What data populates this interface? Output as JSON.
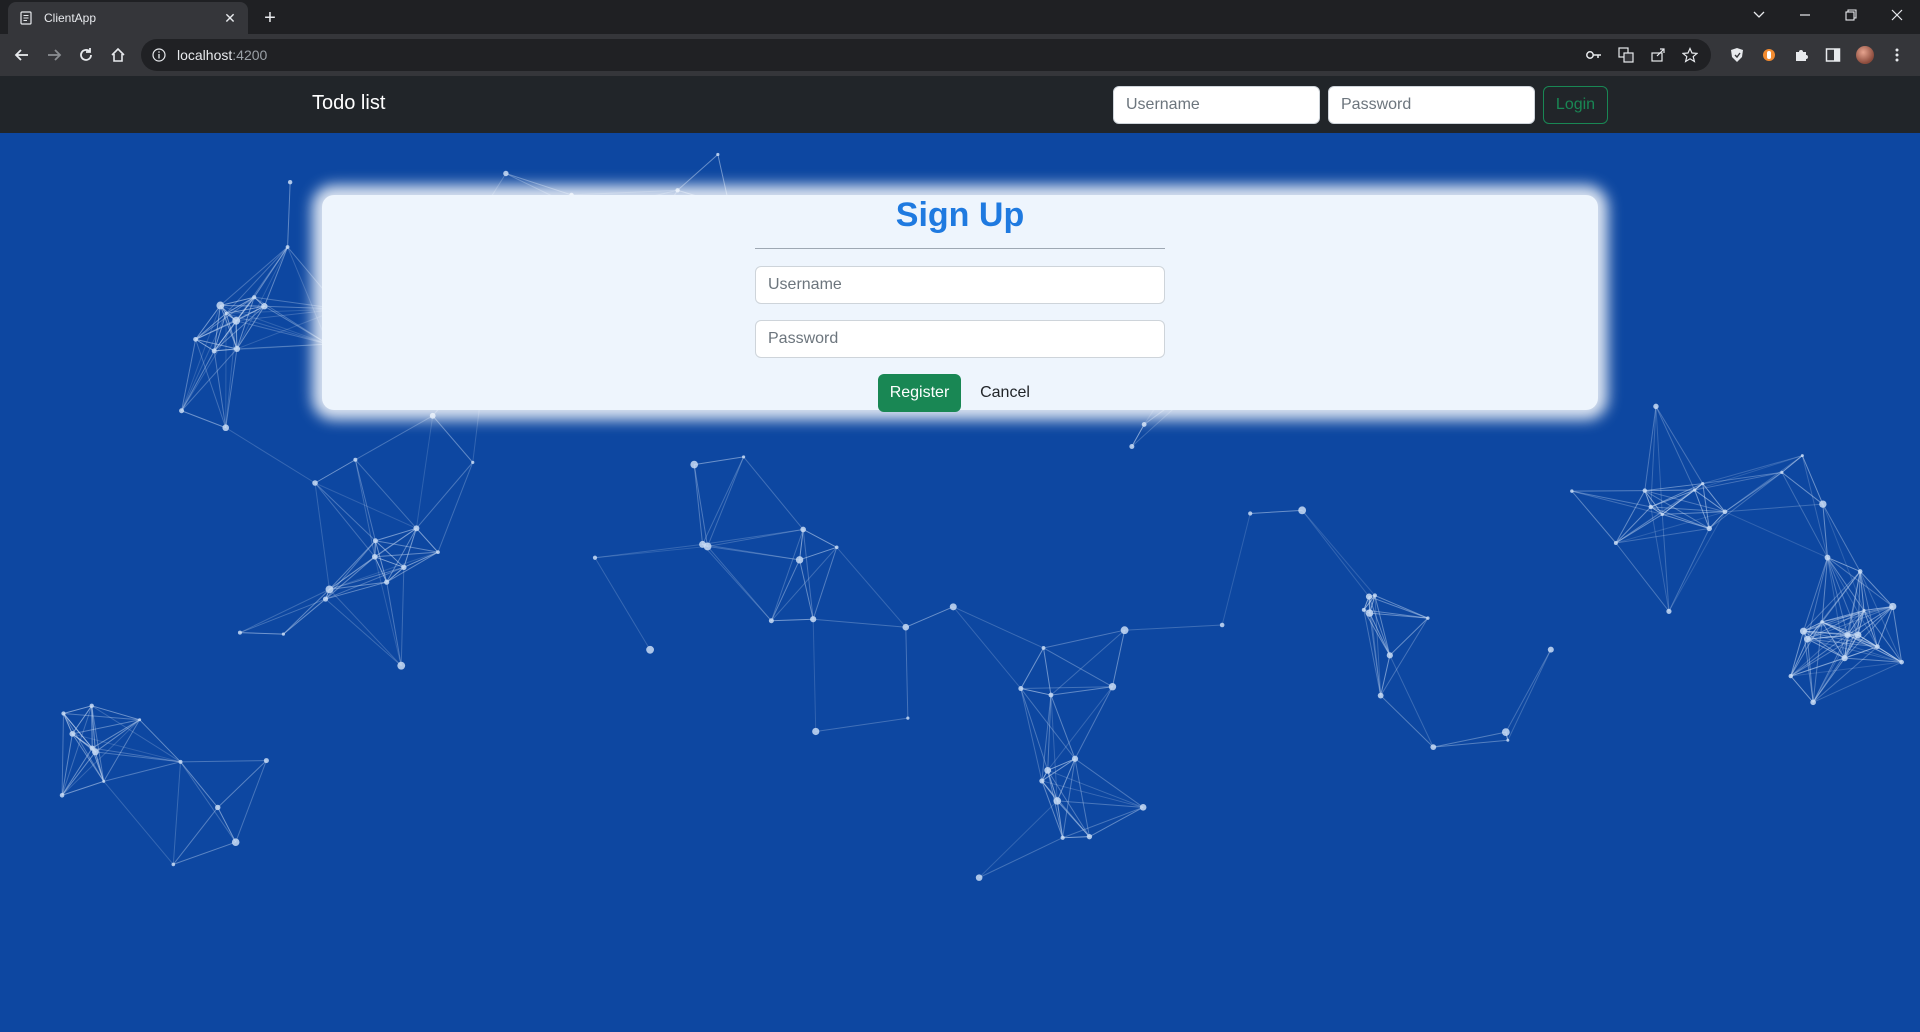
{
  "browser": {
    "tab_title": "ClientApp",
    "tab_icon": "document-icon",
    "url_host": "localhost",
    "url_port": ":4200"
  },
  "navbar": {
    "brand": "Todo list",
    "username_placeholder": "Username",
    "password_placeholder": "Password",
    "login_label": "Login"
  },
  "signup": {
    "title": "Sign Up",
    "username_placeholder": "Username",
    "password_placeholder": "Password",
    "register_label": "Register",
    "cancel_label": "Cancel"
  },
  "colors": {
    "background": "#0d47a1",
    "navbar": "#212529",
    "accent": "#1f7ae0",
    "success": "#198754"
  }
}
